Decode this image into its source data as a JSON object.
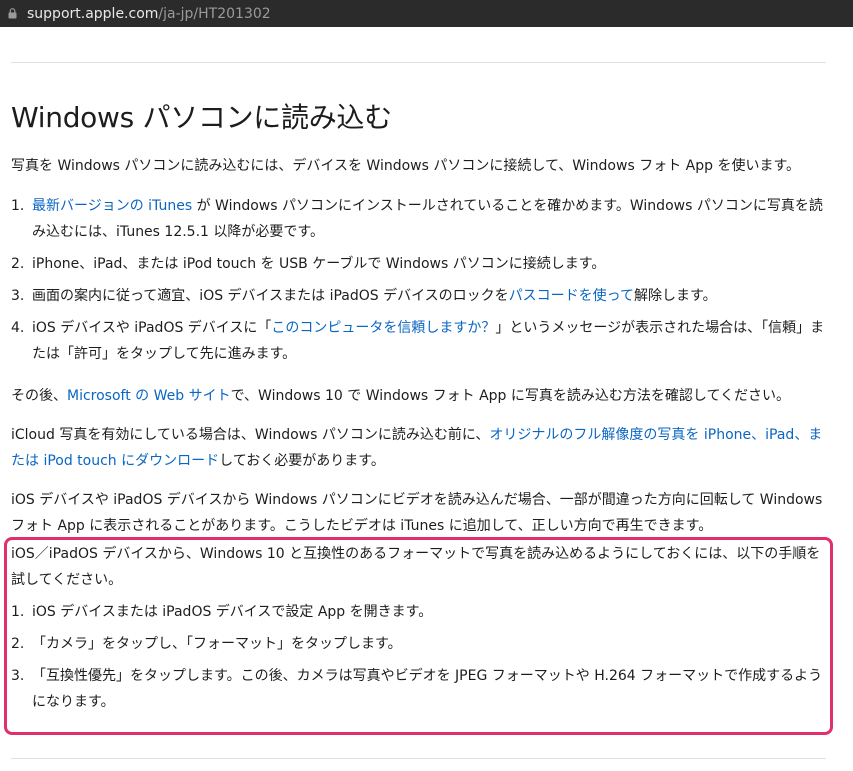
{
  "browser": {
    "url_domain": "support.apple.com",
    "url_path": "/ja-jp/HT201302"
  },
  "article": {
    "title": "Windows パソコンに読み込む",
    "intro": "写真を Windows パソコンに読み込むには、デバイスを Windows パソコンに接続して、Windows フォト App を使います。",
    "steps": [
      {
        "num": "1.",
        "link": "最新バージョンの iTunes",
        "text": " が Windows パソコンにインストールされていることを確かめます。Windows パソコンに写真を読み込むには、iTunes 12.5.1 以降が必要です。"
      },
      {
        "num": "2.",
        "text": "iPhone、iPad、または iPod touch を USB ケーブルで Windows パソコンに接続します。"
      },
      {
        "num": "3.",
        "pre": "画面の案内に従って適宜、iOS デバイスまたは iPadOS デバイスのロックを",
        "link": "パスコードを使って",
        "post": "解除します。"
      },
      {
        "num": "4.",
        "pre": "iOS デバイスや iPadOS デバイスに「",
        "link": "このコンピュータを信頼しますか？",
        "post": "」というメッセージが表示された場合は、「信頼」または「許可」をタップして先に進みます。"
      }
    ],
    "para_ms": {
      "pre": "その後、",
      "link": "Microsoft の Web サイト",
      "post": "で、Windows 10 で Windows フォト App に写真を読み込む方法を確認してください。"
    },
    "para_icloud": {
      "pre": "iCloud 写真を有効にしている場合は、Windows パソコンに読み込む前に、",
      "link": "オリジナルのフル解像度の写真を iPhone、iPad、または iPod touch にダウンロード",
      "post": "しておく必要があります。"
    },
    "para_video": "iOS デバイスや iPadOS デバイスから Windows パソコンにビデオを読み込んだ場合、一部が間違った方向に回転して Windows フォト App に表示されることがあります。こうしたビデオは iTunes に追加して、正しい方向で再生できます。",
    "highlight_intro": "iOS／iPadOS デバイスから、Windows 10 と互換性のあるフォーマットで写真を読み込めるようにしておくには、以下の手順を試してください。",
    "highlight_steps": [
      {
        "num": "1.",
        "text": "iOS デバイスまたは iPadOS デバイスで設定 App を開きます。"
      },
      {
        "num": "2.",
        "text": "「カメラ」をタップし、「フォーマット」をタップします。"
      },
      {
        "num": "3.",
        "text": "「互換性優先」をタップします。この後、カメラは写真やビデオを JPEG フォーマットや H.264 フォーマットで作成するようになります。"
      }
    ]
  },
  "colors": {
    "link": "#0a66c2",
    "highlight_border": "#e0306a"
  }
}
